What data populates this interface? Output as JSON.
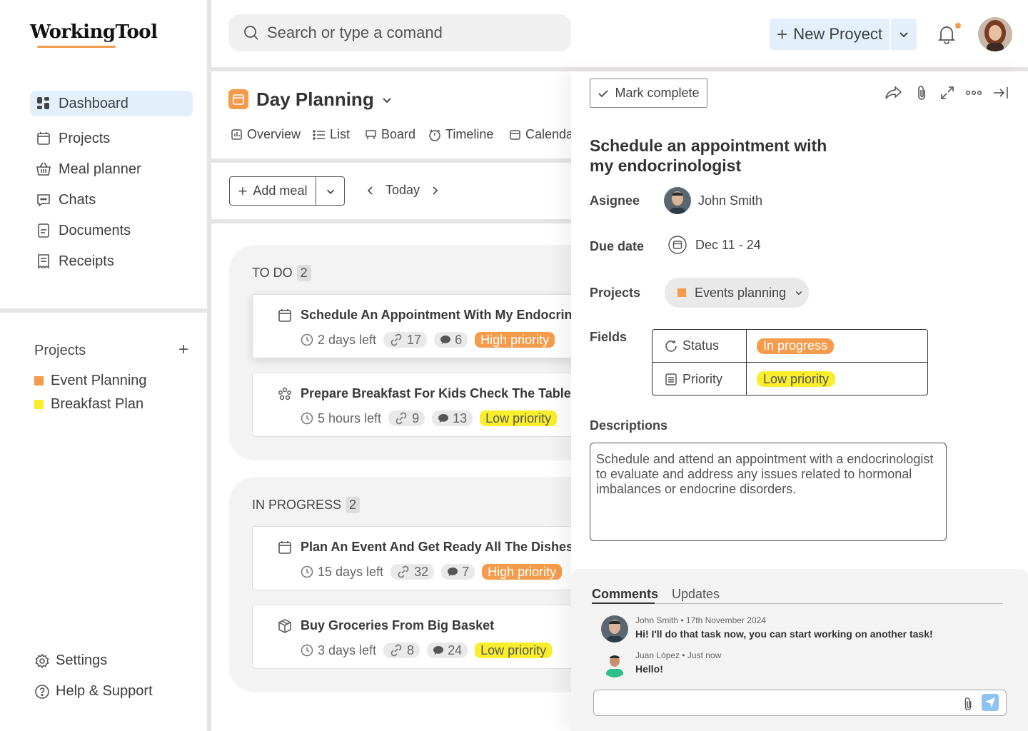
{
  "app": {
    "logo": "WorkingTool"
  },
  "sidebar": {
    "nav": [
      {
        "label": "Dashboard",
        "icon": "dashboard-icon",
        "active": true
      },
      {
        "label": "Projects",
        "icon": "calendar-icon"
      },
      {
        "label": "Meal planner",
        "icon": "basket-icon"
      },
      {
        "label": "Chats",
        "icon": "chat-icon"
      },
      {
        "label": "Documents",
        "icon": "document-icon"
      },
      {
        "label": "Receipts",
        "icon": "receipt-icon"
      }
    ],
    "projects_heading": "Projects",
    "projects": [
      {
        "label": "Event Planning",
        "color": "#f59b4c"
      },
      {
        "label": "Breakfast Plan",
        "color": "#f9ee2c"
      }
    ],
    "settings_label": "Settings",
    "help_label": "Help & Support"
  },
  "header": {
    "search_placeholder": "Search or type a comand",
    "new_project_label": "New Proyect"
  },
  "page": {
    "title": "Day Planning",
    "views": [
      "Overview",
      "List",
      "Board",
      "Timeline",
      "Calendar"
    ],
    "add_meal_label": "Add meal",
    "today_label": "Today"
  },
  "board": {
    "columns": [
      {
        "name": "TO DO",
        "count": "2",
        "cards": [
          {
            "title": "Schedule An Appointment With My Endocrinologist",
            "time": "2 days left",
            "links": "17",
            "comments": "6",
            "priority": "High priority"
          },
          {
            "title": "Prepare Breakfast For Kids Check The Table!",
            "time": "5 hours left",
            "links": "9",
            "comments": "13",
            "priority": "Low priority"
          }
        ]
      },
      {
        "name": "IN PROGRESS",
        "count": "2",
        "cards": [
          {
            "title": "Plan An Event And Get Ready All The Dishes for",
            "time": "15 days left",
            "links": "32",
            "comments": "7",
            "priority": "High priority"
          },
          {
            "title": "Buy Groceries From Big Basket",
            "time": "3 days left",
            "links": "8",
            "comments": "24",
            "priority": "Low priority"
          }
        ]
      }
    ]
  },
  "detail": {
    "mark_complete_label": "Mark complete",
    "title": "Schedule an appointment with my endocrinologist",
    "assignee_label": "Asignee",
    "assignee_name": "John Smith",
    "due_label": "Due date",
    "due_value": "Dec 11 - 24",
    "projects_label": "Projects",
    "project_value": "Events planning",
    "fields_label": "Fields",
    "status_label": "Status",
    "status_value": "In progress",
    "priority_label": "Priority",
    "priority_value": "Low priority",
    "descriptions_label": "Descriptions",
    "description": "Schedule and attend an appointment with a endocrinologist to evaluate and address any issues related to hormonal imbalances or endocrine disorders."
  },
  "comments": {
    "tabs": [
      "Comments",
      "Updates"
    ],
    "items": [
      {
        "meta": "John Smith • 17th November 2024",
        "text": "Hi! I'll do that task now, you can start working on another task!"
      },
      {
        "meta": "Juan López • Just now",
        "text": "Hello!"
      }
    ]
  },
  "colors": {
    "accent": "#f59b4c",
    "active_bg": "#e3f0fc",
    "low": "#f9ee2c"
  }
}
